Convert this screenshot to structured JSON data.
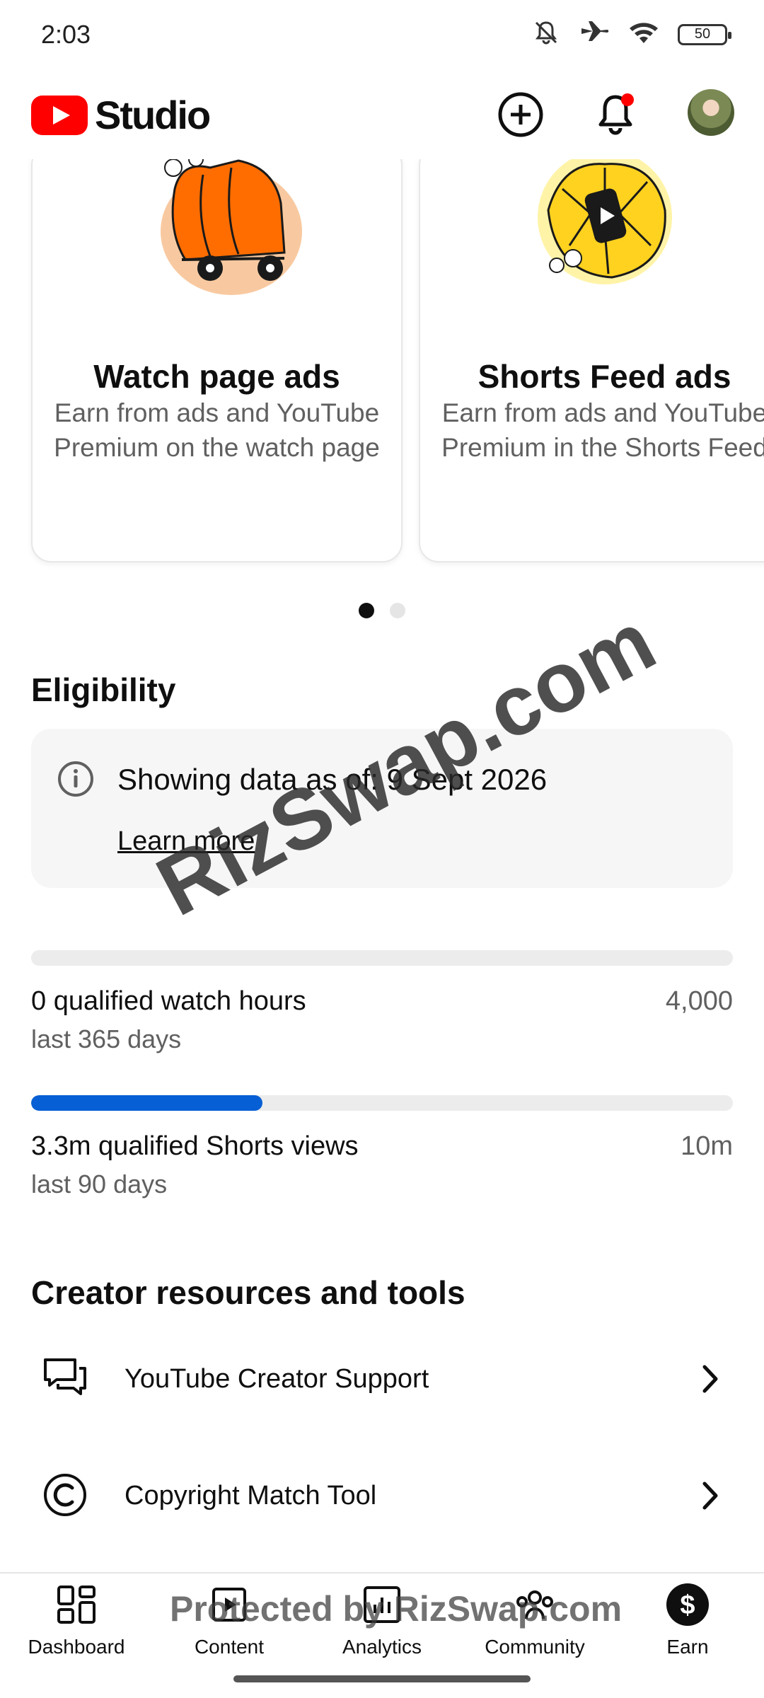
{
  "status_bar": {
    "time": "2:03",
    "battery": "50",
    "icons": [
      "bell-off-icon",
      "airplane-icon",
      "wifi-icon",
      "battery-icon"
    ]
  },
  "header": {
    "brand": "Studio",
    "icons": [
      "youtube-logo-icon",
      "create-plus-icon",
      "notifications-icon",
      "account-avatar"
    ],
    "notification_badge_color": "#ff0000"
  },
  "carousel": {
    "cards": [
      {
        "title": "Watch page ads",
        "description": "Earn from ads and YouTube Premium on the watch page",
        "illustration": "orange-car-illustration"
      },
      {
        "title": "Shorts Feed ads",
        "description": "Earn from ads and YouTube Premium in the Shorts Feed",
        "illustration": "yellow-shorts-illustration"
      }
    ],
    "page_count": 2,
    "active_page": 1
  },
  "eligibility": {
    "title": "Eligibility",
    "info_text": "Showing data as of: 9 Sept 2026",
    "learn_more": "Learn more",
    "metrics": [
      {
        "label": "0 qualified watch hours",
        "period": "last 365 days",
        "target": "4,000",
        "progress": 0.0
      },
      {
        "label": "3.3m qualified Shorts views",
        "period": "last 90 days",
        "target": "10m",
        "progress": 0.33
      }
    ],
    "progress_color": "#065fd4"
  },
  "resources": {
    "title": "Creator resources and tools",
    "items": [
      {
        "label": "YouTube Creator Support",
        "icon": "chat-bubbles-icon"
      },
      {
        "label": "Copyright Match Tool",
        "icon": "copyright-icon"
      }
    ]
  },
  "bottom_nav": {
    "items": [
      {
        "label": "Dashboard",
        "icon": "dashboard-grid-icon"
      },
      {
        "label": "Content",
        "icon": "content-play-icon"
      },
      {
        "label": "Analytics",
        "icon": "analytics-bars-icon"
      },
      {
        "label": "Community",
        "icon": "community-people-icon"
      },
      {
        "label": "Earn",
        "icon": "earn-dollar-icon"
      }
    ],
    "active": "Earn"
  },
  "watermarks": {
    "main": "RizSwap.com",
    "footer": "Protected by RizSwap.com"
  }
}
